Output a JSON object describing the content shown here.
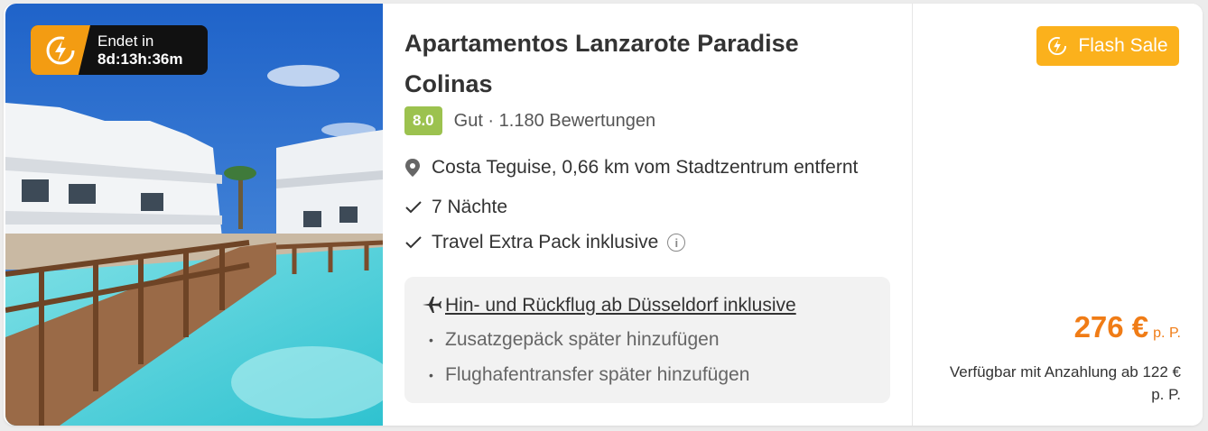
{
  "timer": {
    "label": "Endet in",
    "value": "8d:13h:36m",
    "icon": "flash-clock-icon"
  },
  "hotel": {
    "name": "Apartamentos Lanzarote Paradise Colinas",
    "score": "8.0",
    "rating_text": "Gut · 1.180 Bewertungen",
    "location": "Costa Teguise, 0,66 km vom Stadtzentrum entfernt",
    "nights": "7 Nächte",
    "pack": "Travel Extra Pack inklusive",
    "pack_info": "i"
  },
  "flight": {
    "main": "Hin- und Rückflug ab Düsseldorf inklusive",
    "extra1": "Zusatzgepäck später hinzufügen",
    "extra2": "Flughafentransfer später hinzufügen",
    "bullet": "•"
  },
  "offer": {
    "badge": "Flash Sale",
    "price": "276 €",
    "price_unit": "p. P.",
    "deposit": "Verfügbar mit Anzahlung ab 122 € p. P."
  },
  "colors": {
    "accent": "#f07c16",
    "flash": "#fbb11c",
    "score": "#9cc24f"
  }
}
